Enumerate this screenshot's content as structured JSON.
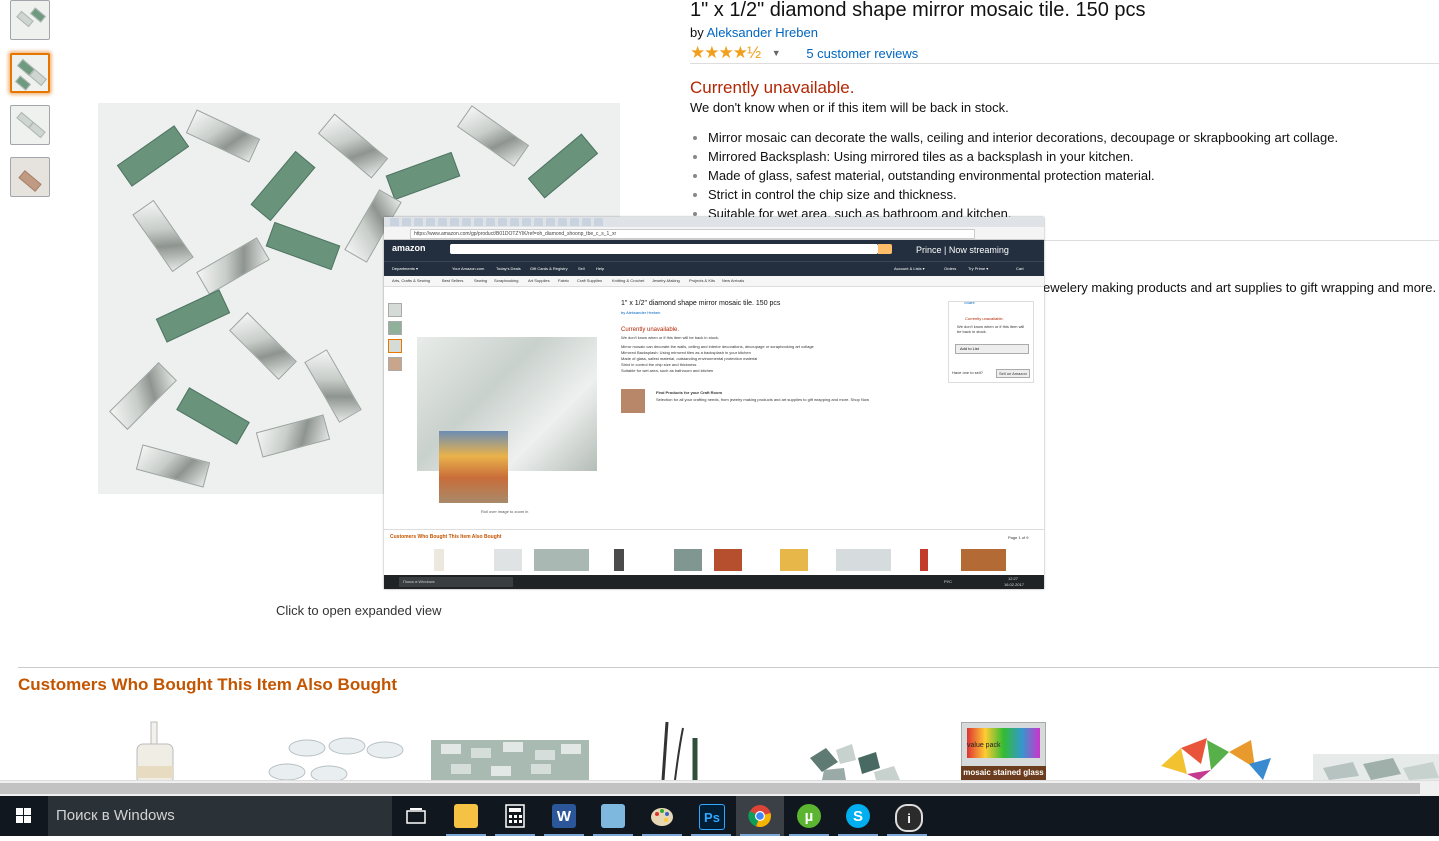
{
  "product": {
    "title": "1\" x 1/2\" diamond shape mirror mosaic tile. 150 pcs",
    "by_prefix": "by",
    "author": "Aleksander Hreben",
    "stars": "★★★★½",
    "rating_caret": "▼",
    "reviews_link": "5 customer reviews",
    "availability": "Currently unavailable.",
    "stock_message": "We don't know when or if this item will be back in stock.",
    "bullets": [
      "Mirror mosaic can decorate the walls, ceiling and interior decorations, decoupage or skrapbooking art collage.",
      "Mirrored Backsplash: Using mirrored tiles as a backsplash in your kitchen.",
      "Made of glass, safest material, outstanding environmental protection material.",
      "Strict in control the chip size and thickness.",
      "Suitable for wet area, such as bathroom and kitchen."
    ],
    "cut_text": "ewelery making products and art supplies to gift wrapping and more."
  },
  "gallery": {
    "expand_text": "Click to open expanded view"
  },
  "embedded": {
    "url": "https://www.amazon.com/gp/product/B01DOTZYIK/ref=oh_diamond_shoonp_tbe_c_s_1_xr",
    "logo": "amazon",
    "prime": "Prince | Now streaming",
    "subnav": [
      "Departments ▾",
      "Your Amazon.com",
      "Today's Deals",
      "Gift Cards & Registry",
      "Sell",
      "Help",
      "Account & Lists ▾",
      "Orders",
      "Try Prime ▾",
      "Cart"
    ],
    "catnav": [
      "Arts, Crafts & Sewing",
      "Best Sellers",
      "Sewing",
      "Scrapbooking",
      "Art Supplies",
      "Fabric",
      "Craft Supplies",
      "Knitting & Crochet",
      "Jewelry-Making",
      "Projects & Kits",
      "New Arrivals"
    ],
    "title": "1\" x 1/2\" diamond shape mirror mosaic tile. 150 pcs",
    "by": "by Aleksander Hreben",
    "unavailable": "Currently unavailable.",
    "stock": "We don't know when or if this item will be back in stock.",
    "lines": [
      "Mirror mosaic can decorate the walls, ceiling and interior decorations, decoupage or scrapbooking art collage",
      "Mirrored Backsplash: Using mirrored tiles as a backsplash in your kitchen",
      "Made of glass, safest material, outstanding environmental protection material",
      "Strict in control the chip size and thickness",
      "Suitable for wet area, such as bathroom and kitchen"
    ],
    "find_title": "Find Products for your Craft Room",
    "find_text": "Selection for all your crafting needs, from jewelry making products and art supplies to gift wrapping and more. Shop Now",
    "zoom": "Roll over image to zoom in",
    "box_unavailable": "Currently unavailable.",
    "box_stock": "We don't know when or if this item will be back in stock.",
    "add_to_list": "Add to List",
    "sell_question": "Have one to sell?",
    "sell_button": "Sell on Amazon",
    "share": "Share",
    "also_bought": "Customers Who Bought This Item Also Bought",
    "page": "Page 1 of 9",
    "taskbar_search": "Поиск в Windows",
    "time": "12:27",
    "date": "16.02.2017",
    "lang": "РУС"
  },
  "also_bought": {
    "title": "Customers Who Bought This Item Also Bought",
    "product_label": "mosaic stained glass",
    "pack_label": "value pack"
  },
  "taskbar": {
    "search_placeholder": "Поиск в Windows",
    "apps": [
      "task-view",
      "file-explorer",
      "calculator",
      "word",
      "notepad",
      "paint",
      "photoshop",
      "chrome",
      "utorrent",
      "skype",
      "app"
    ]
  }
}
